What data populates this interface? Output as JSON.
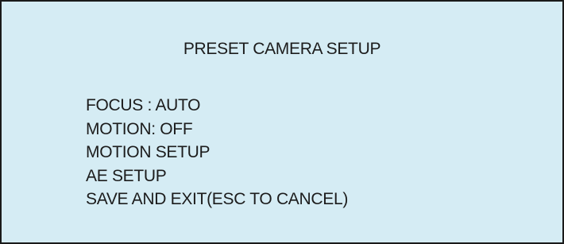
{
  "panel": {
    "title": "PRESET CAMERA SETUP"
  },
  "menu": {
    "items": [
      {
        "label": "FOCUS : AUTO"
      },
      {
        "label": "MOTION: OFF"
      },
      {
        "label": "MOTION SETUP"
      },
      {
        "label": "AE SETUP"
      },
      {
        "label": "SAVE AND EXIT(ESC TO CANCEL)"
      }
    ]
  },
  "colors": {
    "background": "#d5ecf4",
    "border": "#1a1a1a",
    "text": "#1c1c1c"
  }
}
